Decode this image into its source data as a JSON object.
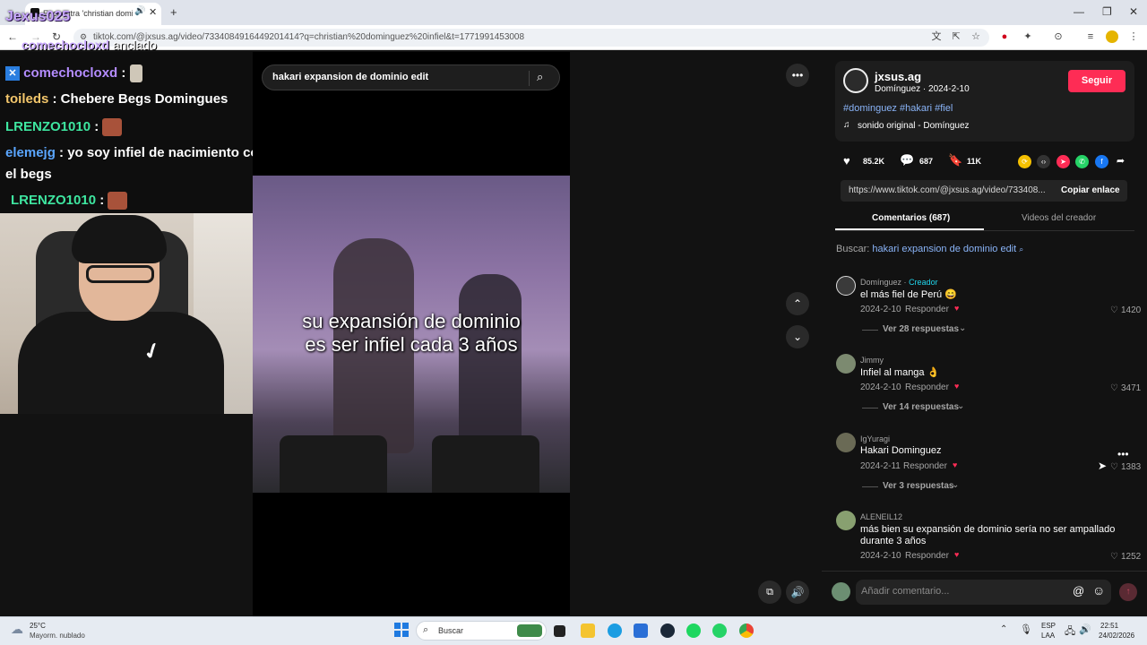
{
  "browser": {
    "tab_title": "Encuentra 'christian domin",
    "url": "tiktok.com/@jxsus.ag/video/7334084916449201414?q=christian%20dominguez%20infiel&t=1771991453008"
  },
  "overlay": {
    "streamer_name": "Jexus025",
    "pinned_user": "comechocloxd",
    "pinned_label": "anclado",
    "chat": [
      {
        "user": "comechocloxd",
        "color": "#b48cff",
        "text": ":"
      },
      {
        "user": "toileds",
        "color": "#f3c66b",
        "text": ": Chebere Begs Domingues"
      },
      {
        "user": "LRENZO1010",
        "color": "#3ee6a0",
        "text": ":"
      },
      {
        "user": "elemejg",
        "color": "#5aa6ff",
        "text": ": yo soy infiel de nacimiento como"
      },
      {
        "user": "",
        "color": "#ffffff",
        "text": "el begs"
      },
      {
        "user": "LRENZO1010",
        "color": "#3ee6a0",
        "text": ":"
      }
    ]
  },
  "player": {
    "search_text": "hakari expansion de dominio edit",
    "caption_line1": "su expansión de dominio",
    "caption_line2": "es ser infiel cada 3 años"
  },
  "author": {
    "handle": "jxsus.ag",
    "display": "Domínguez",
    "date": "2024-2-10",
    "separator": "·",
    "follow_label": "Seguir",
    "hashtags": "#dominguez #hakari #fiel",
    "sound": "sonido original - Domínguez"
  },
  "stats": {
    "likes": "85.2K",
    "comments": "687",
    "saves": "11K"
  },
  "share": {
    "link": "https://www.tiktok.com/@jxsus.ag/video/733408...",
    "copy_label": "Copiar enlace"
  },
  "tabs": {
    "comments": "Comentarios (687)",
    "creator_videos": "Videos del creador"
  },
  "search_related": {
    "label": "Buscar:",
    "query": "hakari expansion de dominio edit"
  },
  "comments": [
    {
      "user": "Domínguez",
      "creator_tag": "Creador",
      "text": "el más fiel de Perú 😄",
      "date": "2024-2-10",
      "reply": "Responder",
      "likes": "1420",
      "replies": "Ver 28 respuestas"
    },
    {
      "user": "Jimmy",
      "creator_tag": "",
      "text": "Infiel al manga 👌",
      "date": "2024-2-10",
      "reply": "Responder",
      "likes": "3471",
      "replies": "Ver 14 respuestas"
    },
    {
      "user": "IgYuragi",
      "creator_tag": "",
      "text": "Hakari Dominguez",
      "date": "2024-2-11",
      "reply": "Responder",
      "likes": "1383",
      "replies": "Ver 3 respuestas"
    },
    {
      "user": "ALENEIL12",
      "creator_tag": "",
      "text": "más bien su expansión de dominio sería no ser ampallado",
      "text2": "durante 3 años",
      "date": "2024-2-10",
      "reply": "Responder",
      "likes": "1252",
      "replies": ""
    }
  ],
  "composer": {
    "placeholder": "Añadir comentario..."
  },
  "taskbar": {
    "temp": "25°C",
    "weather": "Mayorm. nublado",
    "search": "Buscar",
    "lang1": "ESP",
    "lang2": "LAA",
    "time": "22:51",
    "date": "24/02/2026"
  },
  "colors": {
    "accent_red": "#fe2c55",
    "hashtag_blue": "#8ab4f8",
    "creator_tag": "#20d5ec"
  }
}
